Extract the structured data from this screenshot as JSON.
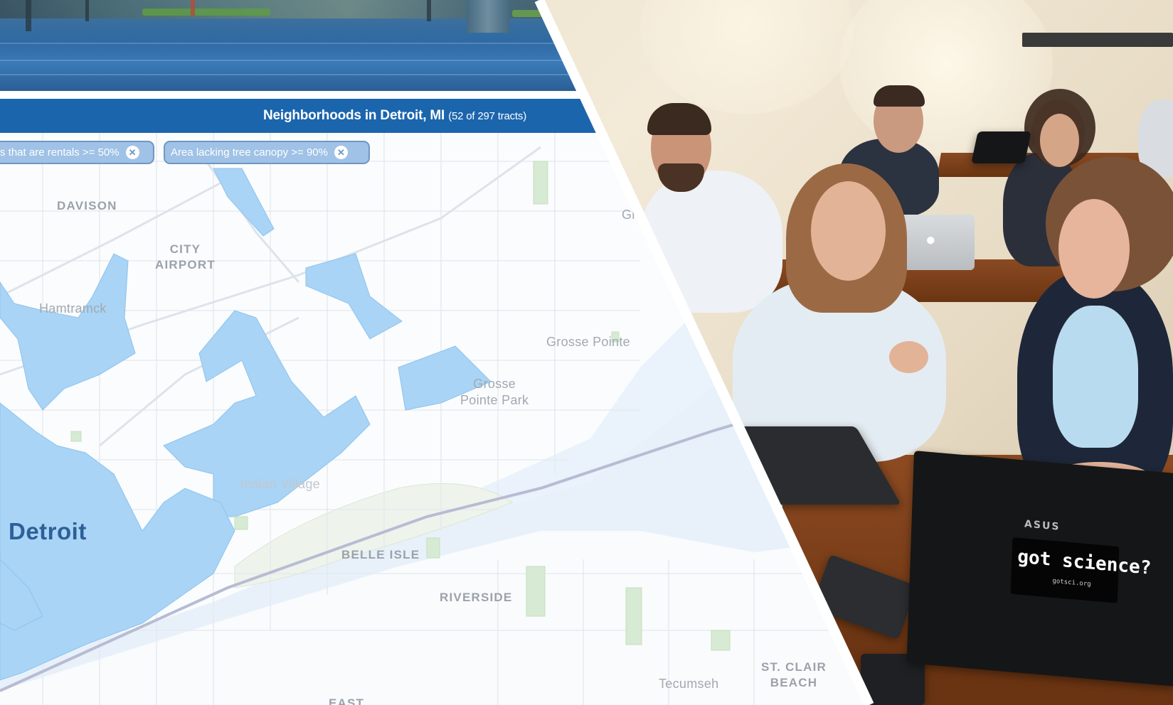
{
  "results_header": {
    "title": "Neighborhoods in Detroit, MI",
    "count": "(52 of 297 tracts)"
  },
  "filters": [
    {
      "label": "s that are rentals >= 50%",
      "remove_icon": "close-circle-icon"
    },
    {
      "label": "Area lacking tree canopy >= 90%",
      "remove_icon": "close-circle-icon"
    }
  ],
  "map_labels": {
    "davison": "DAVISON",
    "city_airport": "CITY\nAIRPORT",
    "hamtramck": "Hamtramck",
    "grosse_pointe": "Grosse Pointe",
    "grosse_pointe_park": "Grosse\nPointe Park",
    "indian_village": "Indian Village",
    "detroit": "Detroit",
    "belle_isle": "BELLE ISLE",
    "riverside": "RIVERSIDE",
    "st_clair_beach": "ST. CLAIR\nBEACH",
    "tecumseh": "Tecumseh",
    "east": "EAST",
    "gr_partial": "Gr"
  },
  "photo": {
    "laptop_sticker": "got science?",
    "laptop_sticker_small": "gotsci.org",
    "laptop_brand": "ASUS"
  },
  "colors": {
    "header_blue": "#1b65ad",
    "highlight_tract": "#a9d4f5",
    "chip_fill": "#9fc2e6",
    "water": "#e6f0fa"
  }
}
